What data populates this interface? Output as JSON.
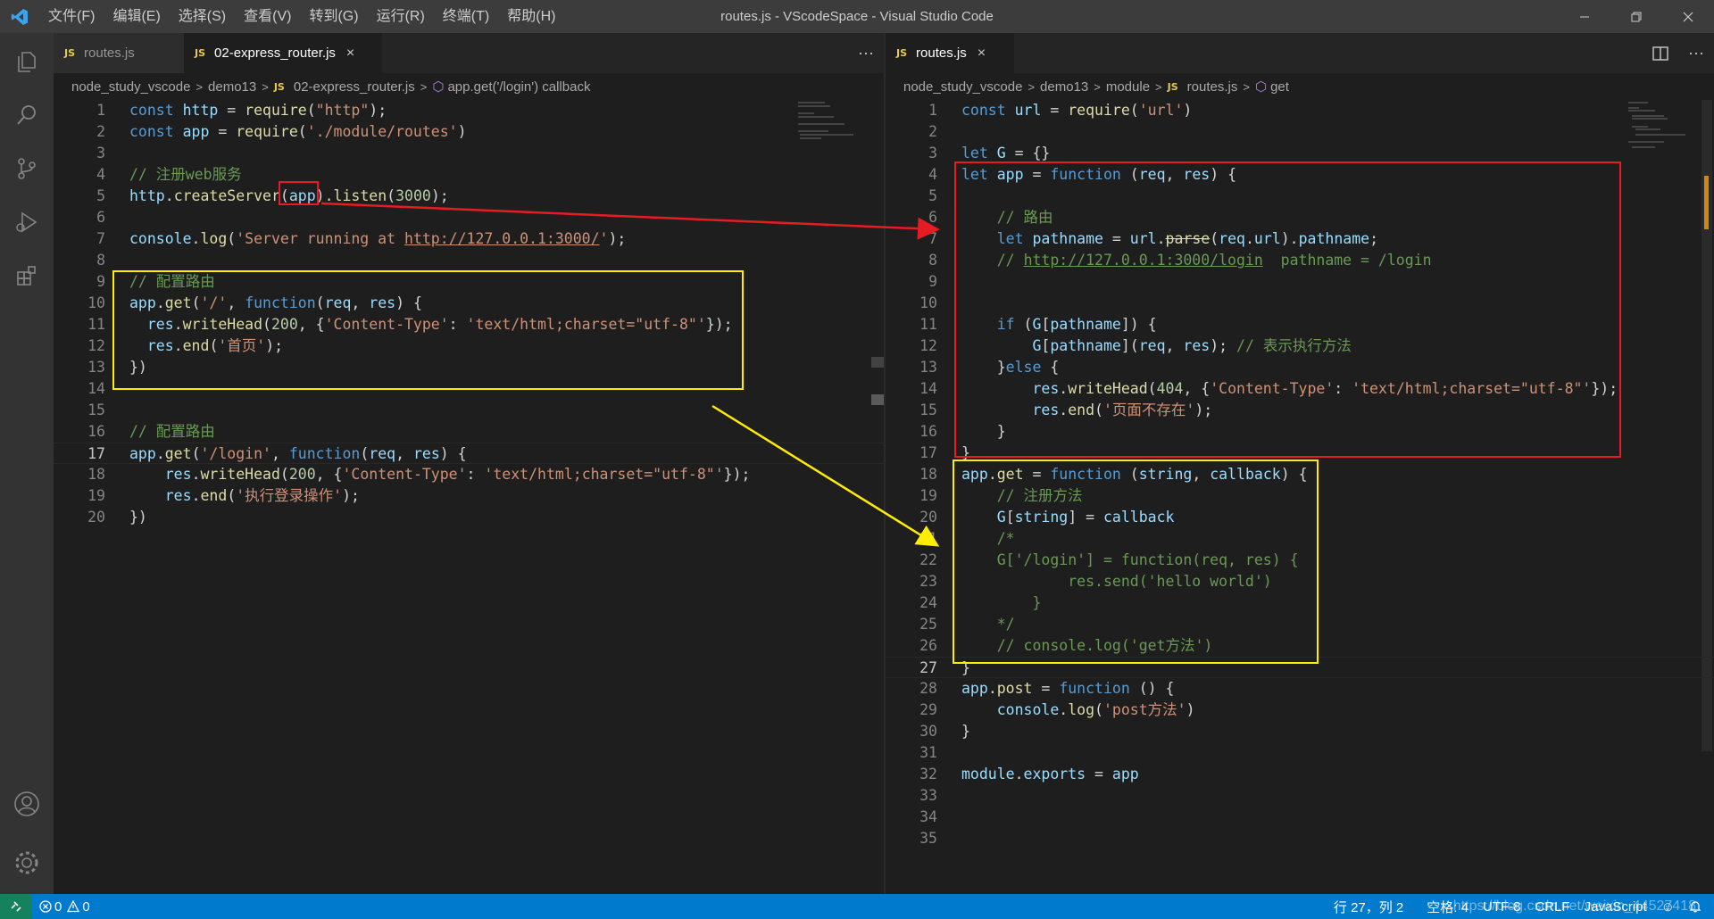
{
  "titlebar": {
    "menus": [
      "文件(F)",
      "编辑(E)",
      "选择(S)",
      "查看(V)",
      "转到(G)",
      "运行(R)",
      "终端(T)",
      "帮助(H)"
    ],
    "title": "routes.js - VScodeSpace - Visual Studio Code"
  },
  "activity_icons": [
    "explorer-icon",
    "search-icon",
    "source-control-icon",
    "run-debug-icon",
    "extensions-icon",
    "account-icon",
    "settings-gear-icon"
  ],
  "left_editor": {
    "tabs": [
      {
        "label": "routes.js",
        "active": false
      },
      {
        "label": "02-express_router.js",
        "active": true
      }
    ],
    "more_actions": "···",
    "breadcrumb": [
      "node_study_vscode",
      "demo13",
      "02-express_router.js",
      "app.get('/login') callback"
    ],
    "current_line": 17
  },
  "right_editor": {
    "tabs": [
      {
        "label": "routes.js",
        "active": true
      }
    ],
    "split_icon": "split-editor-icon",
    "more_actions": "···",
    "breadcrumb": [
      "node_study_vscode",
      "demo13",
      "module",
      "routes.js",
      "get"
    ],
    "current_line": 27
  },
  "statusbar": {
    "errors": "0",
    "warnings": "0",
    "position": "行 27，列 2",
    "indent": "空格: 4",
    "encoding": "UTF-8",
    "eol": "CRLF",
    "language": "JavaScript",
    "watermark": "https://blog.csdn.net/weixin_44527418"
  },
  "colors": {
    "keyword": "#569cd6",
    "string": "#ce9178",
    "function": "#dcdcaa",
    "variable": "#9cdcfe",
    "number": "#b5cea8",
    "comment": "#6a9955",
    "status": "#007acc",
    "annotation_red": "#e51c23",
    "annotation_yellow": "#ffee00"
  }
}
